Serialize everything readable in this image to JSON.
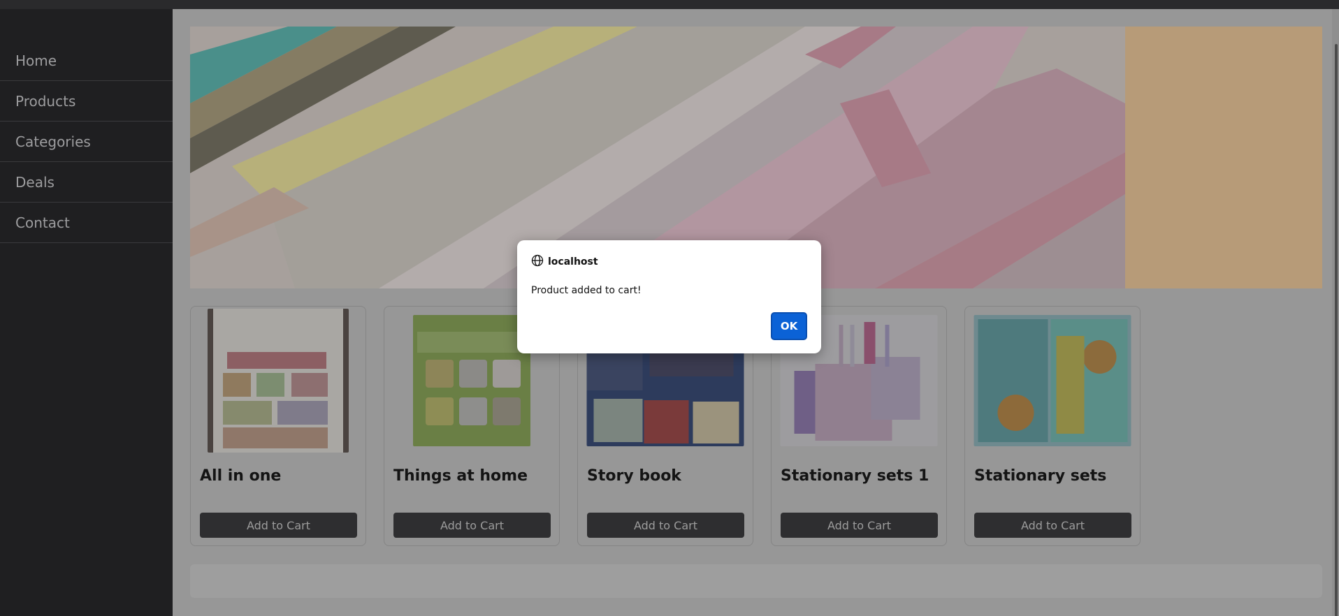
{
  "sidebar": {
    "items": [
      {
        "label": "Home"
      },
      {
        "label": "Products"
      },
      {
        "label": "Categories"
      },
      {
        "label": "Deals"
      },
      {
        "label": "Contact"
      }
    ]
  },
  "products": [
    {
      "title": "All in one",
      "button": "Add to Cart",
      "image": "all-in-one-book-image"
    },
    {
      "title": "Things at home",
      "button": "Add to Cart",
      "image": "things-at-home-book-image"
    },
    {
      "title": "Story book",
      "button": "Add to Cart",
      "image": "story-book-image"
    },
    {
      "title": "Stationary sets 1",
      "button": "Add to Cart",
      "image": "stationary-set-1-image"
    },
    {
      "title": "Stationary sets",
      "button": "Add to Cart",
      "image": "stationary-set-image"
    }
  ],
  "dialog": {
    "origin": "localhost",
    "message": "Product added to cart!",
    "ok_label": "OK"
  },
  "colors": {
    "accent": "#0b62d6",
    "sidebar_bg": "#1f1f21",
    "button_bg": "#2e2e30"
  }
}
